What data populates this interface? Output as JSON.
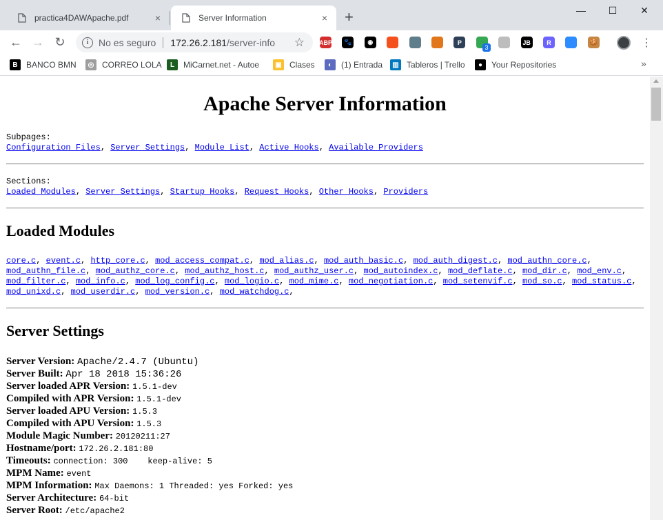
{
  "tabs": [
    {
      "title": "practica4DAWApache.pdf",
      "close": "×"
    },
    {
      "title": "Server Information",
      "close": "×"
    }
  ],
  "new_tab": "+",
  "window_controls": {
    "minimize": "—",
    "maximize": "☐",
    "close": "✕"
  },
  "nav": {
    "back": "←",
    "forward": "→",
    "reload": "↻"
  },
  "omnibox": {
    "security_text": "No es seguro",
    "host": "172.26.2.181",
    "path": "/server-info",
    "star": "☆"
  },
  "extensions": [
    {
      "name": "adblock-plus-icon",
      "label": "ABP",
      "color": "#d32f2f"
    },
    {
      "name": "paw-icon",
      "label": "🐾",
      "color": "#000000"
    },
    {
      "name": "extension-icon",
      "label": "◉",
      "color": "#000000"
    },
    {
      "name": "basketball-icon",
      "label": "",
      "color": "#f4511e"
    },
    {
      "name": "screenshot-icon",
      "label": "",
      "color": "#607d8b"
    },
    {
      "name": "metamask-icon",
      "label": "",
      "color": "#e2761b"
    },
    {
      "name": "presentation-icon",
      "label": "P",
      "color": "#2e4057"
    },
    {
      "name": "status-extension-icon",
      "label": "",
      "color": "#34a853"
    },
    {
      "name": "cube-icon",
      "label": "",
      "color": "#bdbdbd"
    },
    {
      "name": "jetbrains-icon",
      "label": "JB",
      "color": "#000000"
    },
    {
      "name": "r-extension-icon",
      "label": "R",
      "color": "#6c63ff"
    },
    {
      "name": "zoom-icon",
      "label": "",
      "color": "#2d8cff"
    },
    {
      "name": "cookie-icon",
      "label": "🍪",
      "color": "#c68642"
    }
  ],
  "extension_badge": "3",
  "bookmarks": [
    {
      "name": "bookmark-banco-bmn",
      "label": "BANCO BMN",
      "icon_color": "#000000",
      "icon_text": "B"
    },
    {
      "name": "bookmark-correo-lola",
      "label": "CORREO LOLA",
      "icon_color": "#9e9e9e",
      "icon_text": "◎"
    },
    {
      "name": "bookmark-micarnet",
      "label": "MiCarnet.net - Autoe",
      "icon_color": "#1b5e20",
      "icon_text": "L"
    },
    {
      "name": "bookmark-clases",
      "label": "Clases",
      "icon_color": "#fbc02d",
      "icon_text": "▣"
    },
    {
      "name": "bookmark-entrada",
      "label": "(1) Entrada",
      "icon_color": "#5c6bc0",
      "icon_text": "◐"
    },
    {
      "name": "bookmark-trello",
      "label": "Tableros | Trello",
      "icon_color": "#0079bf",
      "icon_text": "▥"
    },
    {
      "name": "bookmark-github",
      "label": "Your Repositories",
      "icon_color": "#000000",
      "icon_text": "●"
    }
  ],
  "bookmarks_more": "»",
  "page": {
    "title": "Apache Server Information",
    "subpages_label": "Subpages:",
    "subpages": [
      "Configuration Files",
      "Server Settings",
      "Module List",
      "Active Hooks",
      "Available Providers"
    ],
    "sections_label": "Sections:",
    "sections": [
      "Loaded Modules",
      "Server Settings",
      "Startup Hooks",
      "Request Hooks",
      "Other Hooks",
      "Providers"
    ],
    "loaded_modules_heading": "Loaded Modules",
    "modules": [
      "core.c",
      "event.c",
      "http_core.c",
      "mod_access_compat.c",
      "mod_alias.c",
      "mod_auth_basic.c",
      "mod_auth_digest.c",
      "mod_authn_core.c",
      "mod_authn_file.c",
      "mod_authz_core.c",
      "mod_authz_host.c",
      "mod_authz_user.c",
      "mod_autoindex.c",
      "mod_deflate.c",
      "mod_dir.c",
      "mod_env.c",
      "mod_filter.c",
      "mod_info.c",
      "mod_log_config.c",
      "mod_logio.c",
      "mod_mime.c",
      "mod_negotiation.c",
      "mod_setenvif.c",
      "mod_so.c",
      "mod_status.c",
      "mod_unixd.c",
      "mod_userdir.c",
      "mod_version.c",
      "mod_watchdog.c"
    ],
    "server_settings_heading": "Server Settings",
    "settings": [
      {
        "label": "Server Version:",
        "value": "Apache/2.4.7 (Ubuntu)",
        "size": "big"
      },
      {
        "label": "Server Built:",
        "value": "Apr 18 2018 15:36:26",
        "size": "big"
      },
      {
        "label": "Server loaded APR Version:",
        "value": "1.5.1-dev",
        "size": "small"
      },
      {
        "label": "Compiled with APR Version:",
        "value": "1.5.1-dev",
        "size": "small"
      },
      {
        "label": "Server loaded APU Version:",
        "value": "1.5.3",
        "size": "small"
      },
      {
        "label": "Compiled with APU Version:",
        "value": "1.5.3",
        "size": "small"
      },
      {
        "label": "Module Magic Number:",
        "value": "20120211:27",
        "size": "small"
      },
      {
        "label": "Hostname/port:",
        "value": "172.26.2.181:80",
        "size": "small"
      },
      {
        "label": "Timeouts:",
        "value": "connection: 300    keep-alive: 5",
        "size": "small"
      },
      {
        "label": "MPM Name:",
        "value": "event",
        "size": "small"
      },
      {
        "label": "MPM Information:",
        "value": "Max Daemons: 1 Threaded: yes Forked: yes",
        "size": "small"
      },
      {
        "label": "Server Architecture:",
        "value": "64-bit",
        "size": "small"
      },
      {
        "label": "Server Root:",
        "value": "/etc/apache2",
        "size": "small"
      }
    ]
  }
}
